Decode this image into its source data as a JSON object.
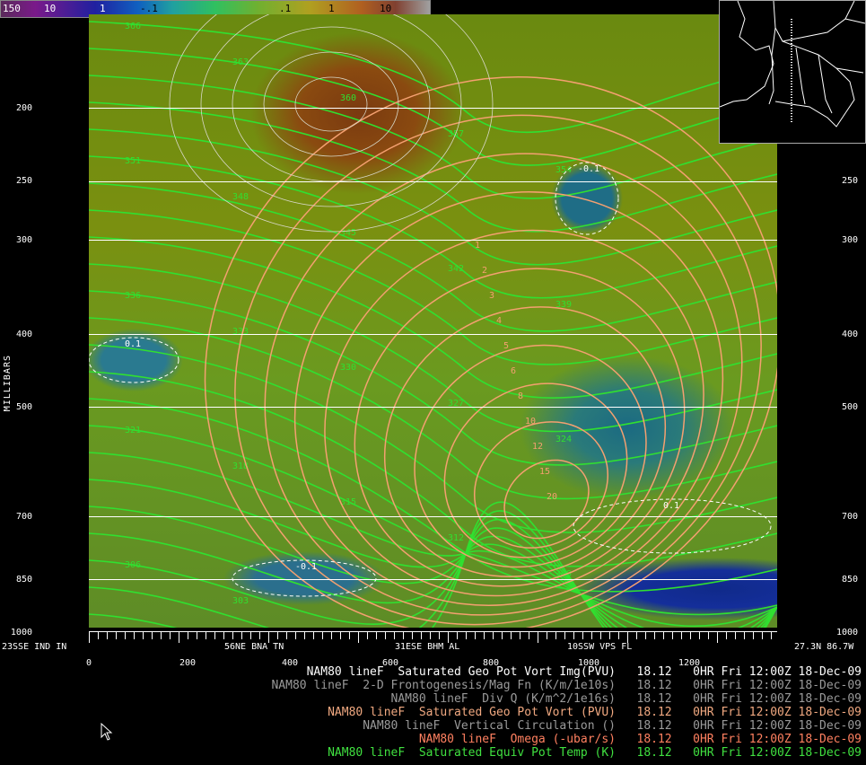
{
  "colorbar": {
    "labels": [
      "150",
      "10",
      "1",
      "-.1",
      ".1",
      "1",
      "10"
    ]
  },
  "y_axis": {
    "title": "MILLIBARS",
    "left_labels": [
      "200",
      "250",
      "300",
      "400",
      "500",
      "700",
      "850",
      "1000"
    ],
    "right_labels": [
      "250",
      "300",
      "400",
      "500",
      "700",
      "850",
      "1000"
    ]
  },
  "x_axis": {
    "ticks": [
      "0",
      "200",
      "400",
      "600",
      "800",
      "1000",
      "1200"
    ],
    "stations": [
      "23SSE IND IN",
      "56NE BNA TN",
      "31ESE BHM AL",
      "10SSW VPS FL",
      "27.3N 86.7W"
    ]
  },
  "legend": [
    {
      "model": "NAM80",
      "line": "lineF",
      "field": "Saturated Geo Pot Vort Img(PVU)",
      "time": "18.12",
      "ohr": "0HR",
      "day": "Fri",
      "z": "12:00Z",
      "date": "18-Dec-09",
      "color": "#ffffff"
    },
    {
      "model": "NAM80",
      "line": "lineF",
      "field": "2-D Frontogenesis/Mag Fn (K/m/1e10s)",
      "time": "18.12",
      "ohr": "0HR",
      "day": "Fri",
      "z": "12:00Z",
      "date": "18-Dec-09",
      "color": "#9a9a9a"
    },
    {
      "model": "NAM80",
      "line": "lineF",
      "field": "Div Q (K/m^2/1e16s)",
      "time": "18.12",
      "ohr": "0HR",
      "day": "Fri",
      "z": "12:00Z",
      "date": "18-Dec-09",
      "color": "#9a9a9a"
    },
    {
      "model": "NAM80",
      "line": "lineF",
      "field": "Saturated Geo Pot Vort (PVU)",
      "time": "18.12",
      "ohr": "0HR",
      "day": "Fri",
      "z": "12:00Z",
      "date": "18-Dec-09",
      "color": "#f0a880"
    },
    {
      "model": "NAM80",
      "line": "lineF",
      "field": "Vertical Circulation ()",
      "time": "18.12",
      "ohr": "0HR",
      "day": "Fri",
      "z": "12:00Z",
      "date": "18-Dec-09",
      "color": "#9a9a9a"
    },
    {
      "model": "NAM80",
      "line": "lineF",
      "field": "Omega (-ubar/s)",
      "time": "18.12",
      "ohr": "0HR",
      "day": "Fri",
      "z": "12:00Z",
      "date": "18-Dec-09",
      "color": "#ff8060"
    },
    {
      "model": "NAM80",
      "line": "lineF",
      "field": "Saturated Equiv Pot Temp (K)",
      "time": "18.12",
      "ohr": "0HR",
      "day": "Fri",
      "z": "12:00Z",
      "date": "18-Dec-09",
      "color": "#40e040"
    }
  ],
  "contour_labels": {
    "theta": [
      "366",
      "363",
      "360",
      "357",
      "354",
      "351",
      "348",
      "345",
      "342",
      "339",
      "336",
      "333",
      "330",
      "327",
      "324",
      "321",
      "318",
      "315",
      "312",
      "309",
      "306",
      "303",
      "300"
    ],
    "pv": [
      "1",
      "2",
      "3",
      "4",
      "5",
      "6",
      "8",
      "10",
      "12",
      "15",
      "20"
    ],
    "omega": [
      "-0.1",
      "0.1"
    ]
  },
  "colors": {
    "theta": "#30e030",
    "pv": "#f4a070",
    "omega": "#ffffff"
  }
}
